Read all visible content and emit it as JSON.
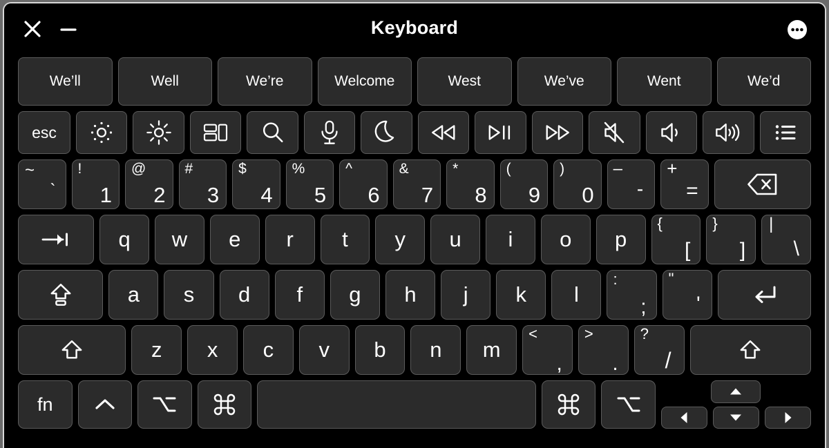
{
  "window": {
    "title": "Keyboard",
    "close_label": "close-icon",
    "minimize_label": "minimize-icon",
    "menu_label": "more-options-icon",
    "background": "#000000",
    "key_fill": "#2b2b2b",
    "key_border": "#5b5b5b",
    "text_color": "#ffffff"
  },
  "suggestions": [
    {
      "label": "We’ll"
    },
    {
      "label": "Well"
    },
    {
      "label": "We’re"
    },
    {
      "label": "Welcome"
    },
    {
      "label": "West"
    },
    {
      "label": "We’ve"
    },
    {
      "label": "Went"
    },
    {
      "label": "We’d"
    }
  ],
  "function_row": [
    {
      "name": "esc",
      "label": "esc",
      "icon": null
    },
    {
      "name": "brightness-down",
      "label": "",
      "icon": "brightness-down-icon"
    },
    {
      "name": "brightness-up",
      "label": "",
      "icon": "brightness-up-icon"
    },
    {
      "name": "mission-control",
      "label": "",
      "icon": "mission-control-icon"
    },
    {
      "name": "spotlight-search",
      "label": "",
      "icon": "search-icon"
    },
    {
      "name": "dictation",
      "label": "",
      "icon": "microphone-icon"
    },
    {
      "name": "do-not-disturb",
      "label": "",
      "icon": "moon-icon"
    },
    {
      "name": "rewind",
      "label": "",
      "icon": "rewind-icon"
    },
    {
      "name": "play-pause",
      "label": "",
      "icon": "play-pause-icon"
    },
    {
      "name": "fast-forward",
      "label": "",
      "icon": "fast-forward-icon"
    },
    {
      "name": "mute",
      "label": "",
      "icon": "mute-icon"
    },
    {
      "name": "volume-down",
      "label": "",
      "icon": "volume-down-icon"
    },
    {
      "name": "volume-up",
      "label": "",
      "icon": "volume-up-icon"
    },
    {
      "name": "list",
      "label": "",
      "icon": "list-icon"
    }
  ],
  "number_row": [
    {
      "name": "grave",
      "shifted": "~",
      "base": "`"
    },
    {
      "name": "1",
      "shifted": "!",
      "base": "1"
    },
    {
      "name": "2",
      "shifted": "@",
      "base": "2"
    },
    {
      "name": "3",
      "shifted": "#",
      "base": "3"
    },
    {
      "name": "4",
      "shifted": "$",
      "base": "4"
    },
    {
      "name": "5",
      "shifted": "%",
      "base": "5"
    },
    {
      "name": "6",
      "shifted": "^",
      "base": "6"
    },
    {
      "name": "7",
      "shifted": "&",
      "base": "7"
    },
    {
      "name": "8",
      "shifted": "*",
      "base": "8"
    },
    {
      "name": "9",
      "shifted": "(",
      "base": "9"
    },
    {
      "name": "0",
      "shifted": ")",
      "base": "0"
    },
    {
      "name": "minus",
      "shifted": "–",
      "base": "-"
    },
    {
      "name": "equal",
      "shifted": "+",
      "base": "="
    }
  ],
  "delete_key": {
    "name": "delete",
    "icon": "delete-icon"
  },
  "qwerty_row": {
    "tab": {
      "name": "tab",
      "icon": "tab-icon"
    },
    "letters": [
      "q",
      "w",
      "e",
      "r",
      "t",
      "y",
      "u",
      "i",
      "o",
      "p"
    ],
    "brackets": [
      {
        "name": "bracket-left",
        "shifted": "{",
        "base": "["
      },
      {
        "name": "bracket-right",
        "shifted": "}",
        "base": "]"
      },
      {
        "name": "backslash",
        "shifted": "|",
        "base": "\\"
      }
    ]
  },
  "asdf_row": {
    "caps": {
      "name": "caps-lock",
      "icon": "caps-lock-icon"
    },
    "letters": [
      "a",
      "s",
      "d",
      "f",
      "g",
      "h",
      "j",
      "k",
      "l"
    ],
    "punct": [
      {
        "name": "semicolon",
        "shifted": ":",
        "base": ";"
      },
      {
        "name": "quote",
        "shifted": "\"",
        "base": "'"
      }
    ],
    "return": {
      "name": "return",
      "icon": "return-icon"
    }
  },
  "zxcv_row": {
    "left_shift": {
      "name": "left-shift",
      "icon": "shift-icon"
    },
    "letters": [
      "z",
      "x",
      "c",
      "v",
      "b",
      "n",
      "m"
    ],
    "punct": [
      {
        "name": "comma",
        "shifted": "<",
        "base": ","
      },
      {
        "name": "period",
        "shifted": ">",
        "base": "."
      },
      {
        "name": "slash",
        "shifted": "?",
        "base": "/"
      }
    ],
    "right_shift": {
      "name": "right-shift",
      "icon": "shift-icon"
    }
  },
  "bottom_row": {
    "fn": {
      "name": "fn",
      "label": "fn"
    },
    "control_left": {
      "name": "control-left",
      "icon": "control-icon"
    },
    "option_left": {
      "name": "option-left",
      "icon": "option-icon"
    },
    "command_left": {
      "name": "command-left",
      "icon": "command-icon"
    },
    "space": {
      "name": "space",
      "label": ""
    },
    "command_right": {
      "name": "command-right",
      "icon": "command-icon"
    },
    "option_right": {
      "name": "option-right",
      "icon": "option-icon"
    },
    "arrows": [
      {
        "name": "arrow-up",
        "icon": "arrow-up-icon"
      },
      {
        "name": "arrow-left",
        "icon": "arrow-left-icon"
      },
      {
        "name": "arrow-down",
        "icon": "arrow-down-icon"
      },
      {
        "name": "arrow-right",
        "icon": "arrow-right-icon"
      }
    ]
  }
}
